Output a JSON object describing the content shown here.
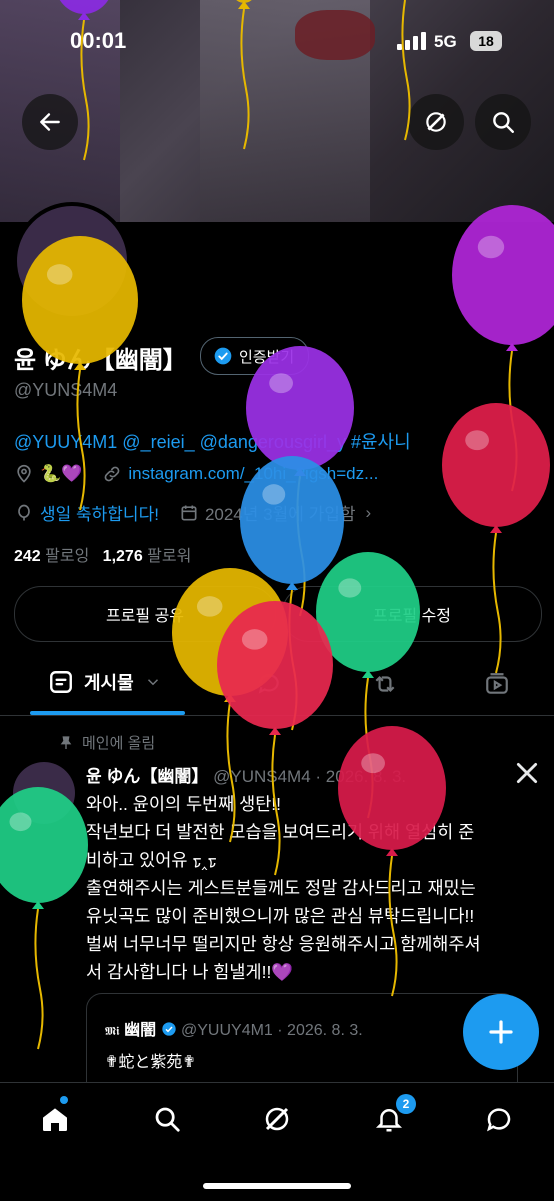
{
  "status_bar": {
    "time": "00:01",
    "network": "5G",
    "battery": "18"
  },
  "profile": {
    "name": "윤 ゆん【幽闇】",
    "verify_label": "인증받기",
    "handle": "@YUNS4M4",
    "bio": "@YUUY4M1 @_reiei_ @dangerousgirl_y #윤사니",
    "location_emoji": "🐍💜",
    "link": "instagram.com/_10hi_?igsh=dz...",
    "birthday": "생일 축하합니다!",
    "joined": "2024년 3월에 가입함",
    "following_count": "242",
    "following_label": "팔로잉",
    "followers_count": "1,276",
    "followers_label": "팔로워"
  },
  "buttons": {
    "share": "프로필 공유",
    "edit": "프로필 수정"
  },
  "tabs": {
    "posts": "게시물"
  },
  "post": {
    "pinned_label": "메인에 올림",
    "author": "윤 ゆん【幽闇】",
    "author_handle": "@YUNS4M4",
    "date": "· 2026. 8. 3.",
    "lines": [
      "와아.. 윤이의 두번째 생탄!!",
      "작년보다 더 발전한 모습을 보여드리기 위해 열심히 준",
      "비하고 있어유 ᢧ‸ᢧ",
      "출연해주시는 게스트분들께도 정말 감사드리고 재밌는",
      "유닛곡도 많이 준비했으니까 많은 관심 뷰탁드립니다!!",
      "벌써 너무너무 떨리지만 항상 응원해주시고 함께해주셔",
      "서 감사합니다 나 힘낼게!!💜"
    ],
    "quote": {
      "author": "幽闇",
      "handle": "@YUUY4M1",
      "date": "· 2026. 8. 3.",
      "text": "✟蛇と紫苑✟"
    }
  },
  "nav": {
    "notification_count": "2"
  },
  "balloons": [
    {
      "color": "#8a2be2"
    },
    {
      "color": "#e6b800"
    },
    {
      "color": "#9b30e6"
    },
    {
      "color": "#b026d8"
    },
    {
      "color": "#e01e4a"
    },
    {
      "color": "#2b8fe6"
    },
    {
      "color": "#e6b800"
    },
    {
      "color": "#1fcf86"
    },
    {
      "color": "#e8284f"
    },
    {
      "color": "#d81b4a"
    },
    {
      "color": "#1fcf86"
    },
    {
      "color": "#e6b800"
    },
    {
      "color": "#1fcf86"
    }
  ]
}
